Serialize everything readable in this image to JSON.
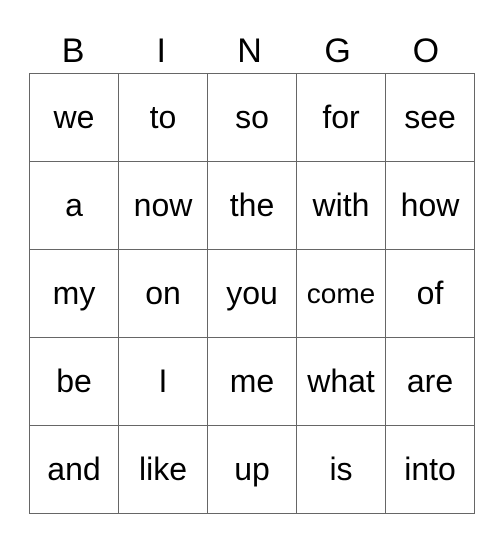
{
  "header": [
    "B",
    "I",
    "N",
    "G",
    "O"
  ],
  "rows": [
    [
      "we",
      "to",
      "so",
      "for",
      "see"
    ],
    [
      "a",
      "now",
      "the",
      "with",
      "how"
    ],
    [
      "my",
      "on",
      "you",
      "come",
      "of"
    ],
    [
      "be",
      "I",
      "me",
      "what",
      "are"
    ],
    [
      "and",
      "like",
      "up",
      "is",
      "into"
    ]
  ]
}
